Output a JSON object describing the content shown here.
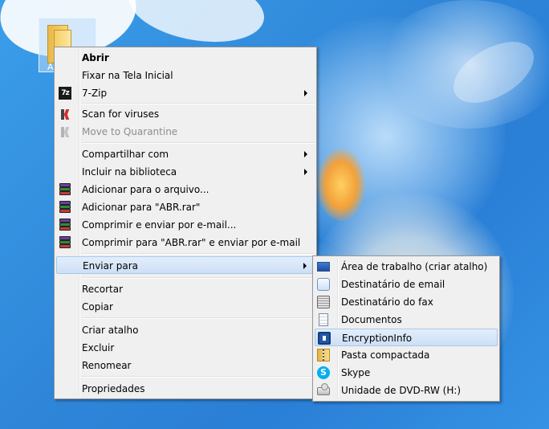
{
  "desktop": {
    "icon_label": "A"
  },
  "context_menu": {
    "items": [
      {
        "label": "Abrir",
        "icon": ""
      },
      {
        "label": "Fixar na Tela Inicial",
        "icon": ""
      },
      {
        "label": "7-Zip",
        "icon": "7zip-icon"
      },
      {
        "label": "Scan for viruses",
        "icon": "kaspersky-icon"
      },
      {
        "label": "Move to Quarantine",
        "icon": "kaspersky-icon"
      },
      {
        "label": "Compartilhar com",
        "icon": ""
      },
      {
        "label": "Incluir na biblioteca",
        "icon": ""
      },
      {
        "label": "Adicionar para o arquivo...",
        "icon": "winrar-icon"
      },
      {
        "label": "Adicionar para \"ABR.rar\"",
        "icon": "winrar-icon"
      },
      {
        "label": "Comprimir e enviar por e-mail...",
        "icon": "winrar-icon"
      },
      {
        "label": "Comprimir para \"ABR.rar\" e enviar por e-mail",
        "icon": "winrar-icon"
      },
      {
        "label": "Enviar para",
        "icon": ""
      },
      {
        "label": "Recortar",
        "icon": ""
      },
      {
        "label": "Copiar",
        "icon": ""
      },
      {
        "label": "Criar atalho",
        "icon": ""
      },
      {
        "label": "Excluir",
        "icon": ""
      },
      {
        "label": "Renomear",
        "icon": ""
      },
      {
        "label": "Propriedades",
        "icon": ""
      }
    ]
  },
  "send_to_menu": {
    "items": [
      {
        "label": "Área de trabalho (criar atalho)",
        "icon": "desktop-icon"
      },
      {
        "label": "Destinatário de email",
        "icon": "mail-icon"
      },
      {
        "label": "Destinatário do fax",
        "icon": "fax-icon"
      },
      {
        "label": "Documentos",
        "icon": "document-icon"
      },
      {
        "label": "EncryptionInfo",
        "icon": "encryption-icon"
      },
      {
        "label": "Pasta compactada",
        "icon": "zip-folder-icon"
      },
      {
        "label": "Skype",
        "icon": "skype-icon"
      },
      {
        "label": "Unidade de DVD-RW (H:)",
        "icon": "dvd-drive-icon"
      }
    ]
  },
  "colors": {
    "menu_background": "#f0f0f0",
    "highlight": "#cddff6",
    "highlight_border": "#a8c8ec",
    "disabled_text": "#8d8d8d",
    "skype": "#00aff0"
  }
}
